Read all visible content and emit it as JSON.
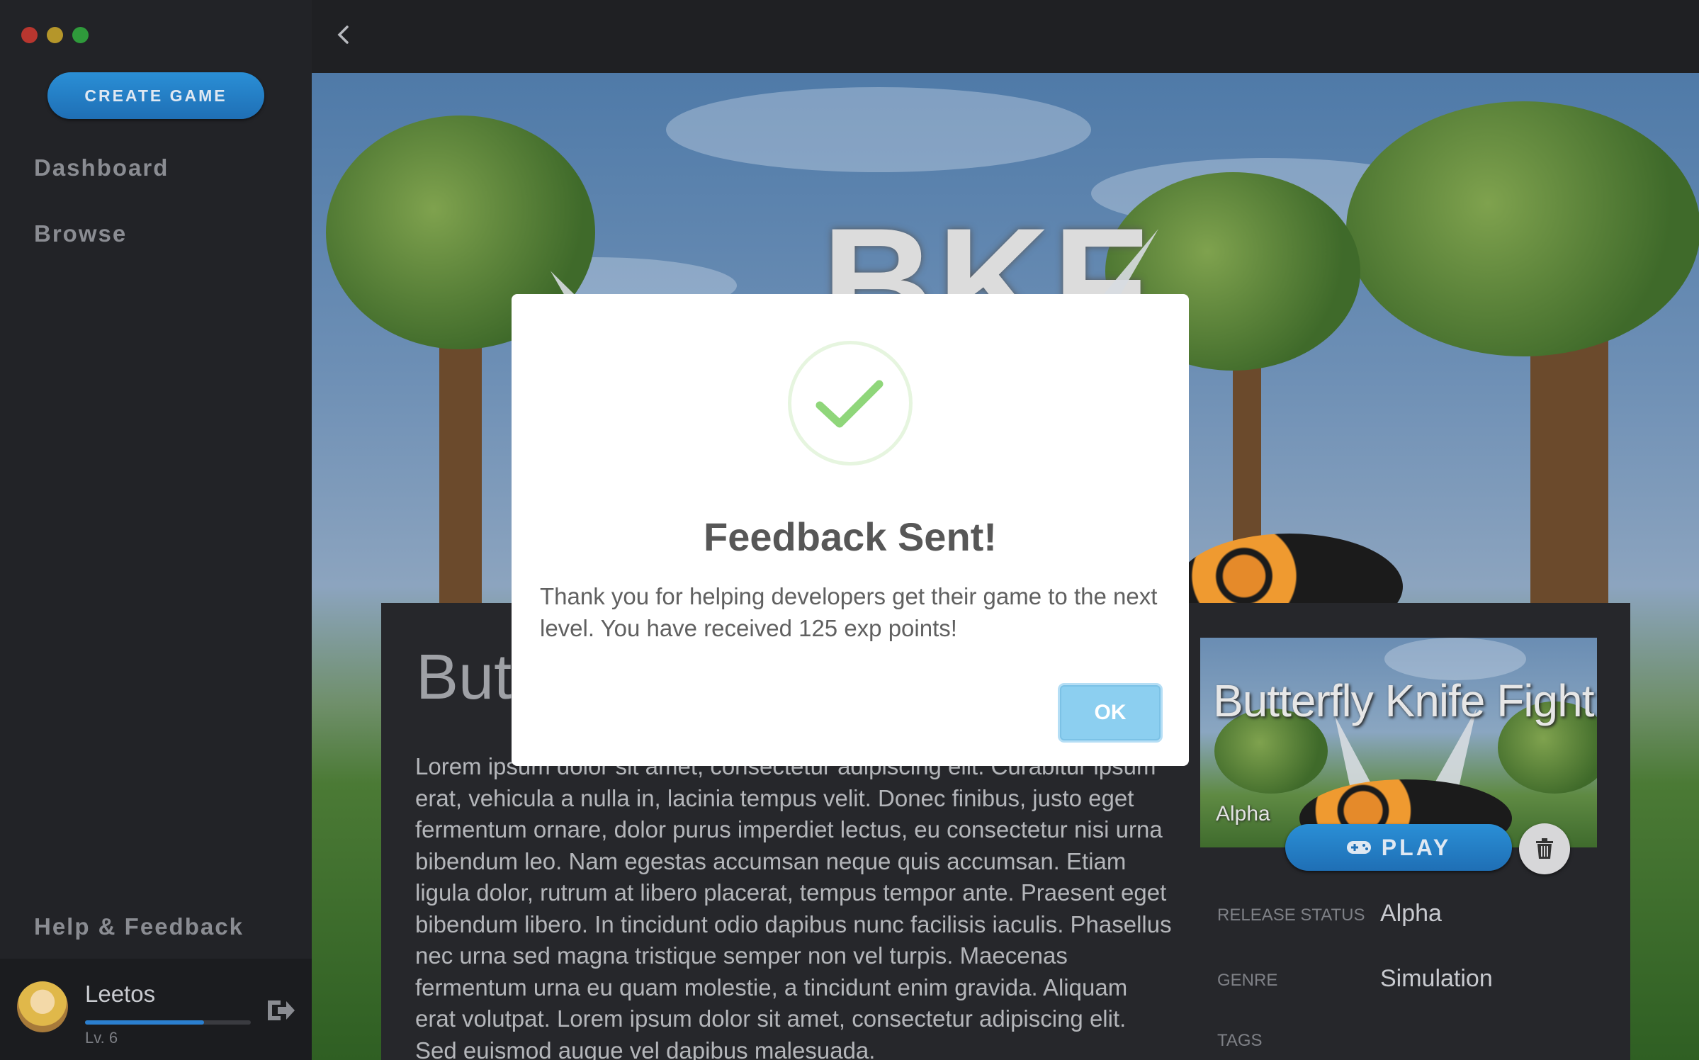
{
  "app": {
    "create_game_label": "CREATE GAME",
    "nav": [
      "Dashboard",
      "Browse"
    ],
    "help_label": "Help & Feedback",
    "user": {
      "name": "Leetos",
      "level": "Lv. 6",
      "xp_progress": 0.72
    }
  },
  "game": {
    "hero_title": "BKF",
    "title": "Butt",
    "description": "Lorem ipsum dolor sit amet, consectetur adipiscing elit. Curabitur ipsum erat, vehicula a nulla in, lacinia tempus velit. Donec finibus, justo eget fermentum ornare, dolor purus imperdiet lectus, eu consectetur nisi urna bibendum leo. Nam egestas accumsan neque quis accumsan. Etiam ligula dolor, rutrum at libero placerat, tempus tempor ante. Praesent eget bibendum libero. In tincidunt odio dapibus nunc facilisis iaculis. Phasellus nec urna sed magna tristique semper non vel turpis. Maecenas fermentum urna eu quam molestie, a tincidunt enim gravida. Aliquam erat volutpat. Lorem ipsum dolor sit amet, consectetur adipiscing elit. Sed euismod augue vel dapibus malesuada.",
    "thumbnail_title": "Butterfly Knife Fight",
    "thumbnail_status": "Alpha",
    "play_label": "PLAY",
    "meta": {
      "release_status_label": "RELEASE STATUS",
      "release_status_value": "Alpha",
      "genre_label": "GENRE",
      "genre_value": "Simulation",
      "tags_label": "TAGS"
    }
  },
  "modal": {
    "title": "Feedback Sent!",
    "message": "Thank you for helping developers get their game to the next level. You have received 125 exp points!",
    "ok_label": "OK"
  },
  "colors": {
    "accent": "#2a8fd6",
    "success": "#8fd67a",
    "ok_button": "#8ccff0"
  }
}
